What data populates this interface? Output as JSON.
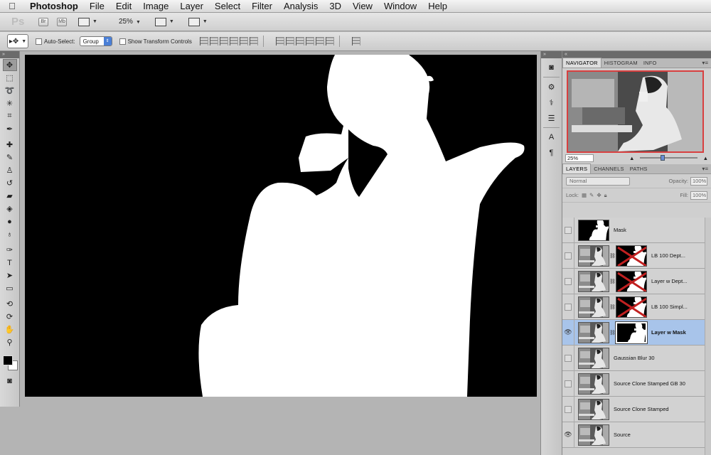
{
  "menubar": {
    "app": "Photoshop",
    "items": [
      "File",
      "Edit",
      "Image",
      "Layer",
      "Select",
      "Filter",
      "Analysis",
      "3D",
      "View",
      "Window",
      "Help"
    ]
  },
  "appbar": {
    "ps": "Ps",
    "br": "Br",
    "mb": "Mb",
    "zoom": "25%"
  },
  "options": {
    "auto_select": "Auto-Select:",
    "auto_select_value": "Group",
    "show_transform": "Show Transform Controls"
  },
  "navigator": {
    "tabs": [
      "NAVIGATOR",
      "HISTOGRAM",
      "INFO"
    ],
    "zoom": "25%"
  },
  "layers_panel": {
    "tabs": [
      "LAYERS",
      "CHANNELS",
      "PATHS"
    ],
    "blend_mode": "Normal",
    "opacity_label": "Opacity:",
    "opacity": "100%",
    "lock_label": "Lock:",
    "fill_label": "Fill:",
    "fill": "100%"
  },
  "layers": [
    {
      "name": "Mask",
      "visible": false,
      "thumb": "mask",
      "has_mask": false
    },
    {
      "name": "LB 100 Dept...",
      "visible": false,
      "thumb": "photo",
      "has_mask": true,
      "mask": "crossed"
    },
    {
      "name": "Layer w Dept...",
      "visible": false,
      "thumb": "photo",
      "has_mask": true,
      "mask": "crossed"
    },
    {
      "name": "LB 100 Simpl...",
      "visible": false,
      "thumb": "photo",
      "has_mask": true,
      "mask": "crossed"
    },
    {
      "name": "Layer w Mask",
      "visible": true,
      "thumb": "photo",
      "has_mask": true,
      "mask": "silhouette",
      "active": true
    },
    {
      "name": "Gaussian Blur 30",
      "visible": false,
      "thumb": "photo",
      "has_mask": false
    },
    {
      "name": "Source Clone Stamped GB 30",
      "visible": false,
      "thumb": "photo",
      "has_mask": false
    },
    {
      "name": "Source Clone Stamped",
      "visible": false,
      "thumb": "photo",
      "has_mask": false
    },
    {
      "name": "Source",
      "visible": true,
      "thumb": "photo",
      "has_mask": false
    }
  ],
  "colors": {
    "accent": "#4a7fd6",
    "active_layer": "#a8c4ea",
    "navigator_frame": "#d84040"
  }
}
